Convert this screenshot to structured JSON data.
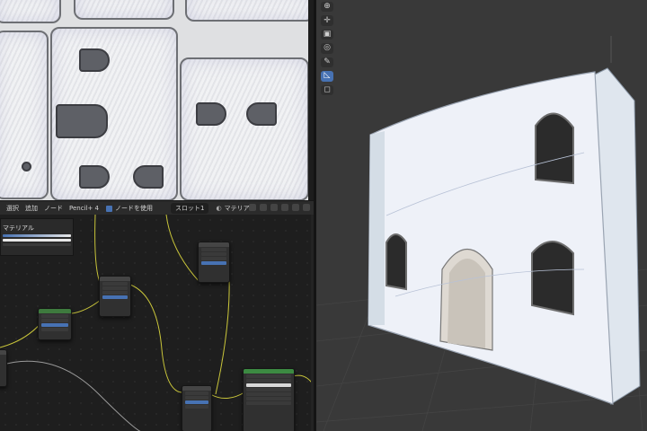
{
  "node_editor": {
    "menu": {
      "select": "選択",
      "add": "追加",
      "node": "ノード",
      "object": "Pencil+ 4",
      "use_nodes": "ノードを使用"
    },
    "slot": "スロット1",
    "material_label": "マテリアル",
    "material_panel_title": "マテリアル"
  },
  "viewport": {
    "tools": [
      {
        "name": "cursor-tool",
        "icon": "⊕"
      },
      {
        "name": "move-tool",
        "icon": "✛"
      },
      {
        "name": "scale-tool",
        "icon": "▣"
      },
      {
        "name": "transform-tool",
        "icon": "◎"
      },
      {
        "name": "annotate-tool",
        "icon": "✎"
      },
      {
        "name": "measure-tool",
        "icon": "◺"
      },
      {
        "name": "add-cube-tool",
        "icon": "◻"
      }
    ]
  },
  "colors": {
    "accent": "#4772b3",
    "wire": "#c9c53a",
    "wire_gray": "#9a9a9a",
    "shader_header": "#3c8a42",
    "header": "#454545"
  }
}
